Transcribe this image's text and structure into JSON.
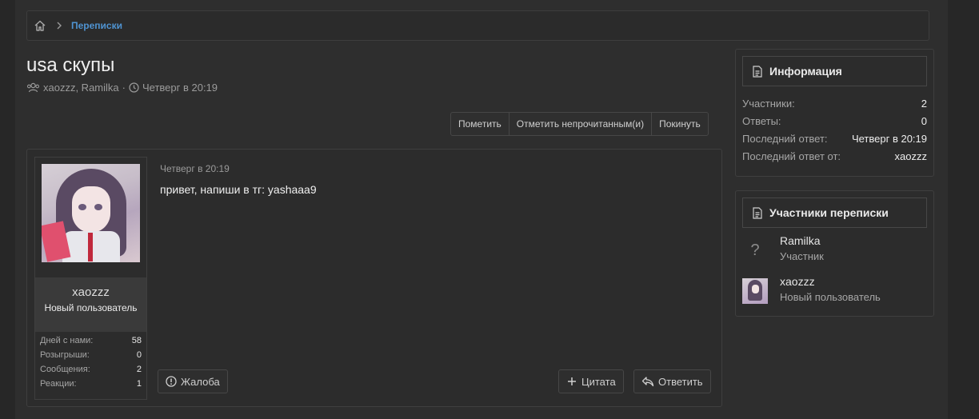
{
  "breadcrumb": {
    "home_icon": "home-icon",
    "separator_icon": "chevron-right-icon",
    "current": "Переписки"
  },
  "thread": {
    "title": "usa скупы",
    "participants_text": "xaozzz, Ramilka",
    "separator": "·",
    "date": "Четверг в 20:19"
  },
  "actions": [
    "Пометить",
    "Отметить непрочитанным(и)",
    "Покинуть"
  ],
  "post": {
    "date": "Четверг в 20:19",
    "message": "привет, напиши в тг: yashaaa9",
    "author": {
      "name": "xaozzz",
      "rank": "Новый пользователь",
      "stats": [
        {
          "label": "Дней с нами:",
          "value": "58"
        },
        {
          "label": "Розыгрыши:",
          "value": "0"
        },
        {
          "label": "Сообщения:",
          "value": "2"
        },
        {
          "label": "Реакции:",
          "value": "1"
        }
      ]
    },
    "report_label": "Жалоба",
    "quote_label": "Цитата",
    "reply_label": "Ответить"
  },
  "info_block": {
    "title": "Информация",
    "rows": [
      {
        "label": "Участники:",
        "value": "2"
      },
      {
        "label": "Ответы:",
        "value": "0"
      },
      {
        "label": "Последний ответ:",
        "value": "Четверг в 20:19"
      },
      {
        "label": "Последний ответ от:",
        "value": "xaozzz"
      }
    ]
  },
  "participants_block": {
    "title": "Участники переписки",
    "members": [
      {
        "name": "Ramilka",
        "role": "Участник",
        "avatar": "?"
      },
      {
        "name": "xaozzz",
        "role": "Новый пользователь",
        "avatar": ""
      }
    ]
  },
  "colors": {
    "link": "#4f93d1",
    "background": "#2e2e2e"
  }
}
